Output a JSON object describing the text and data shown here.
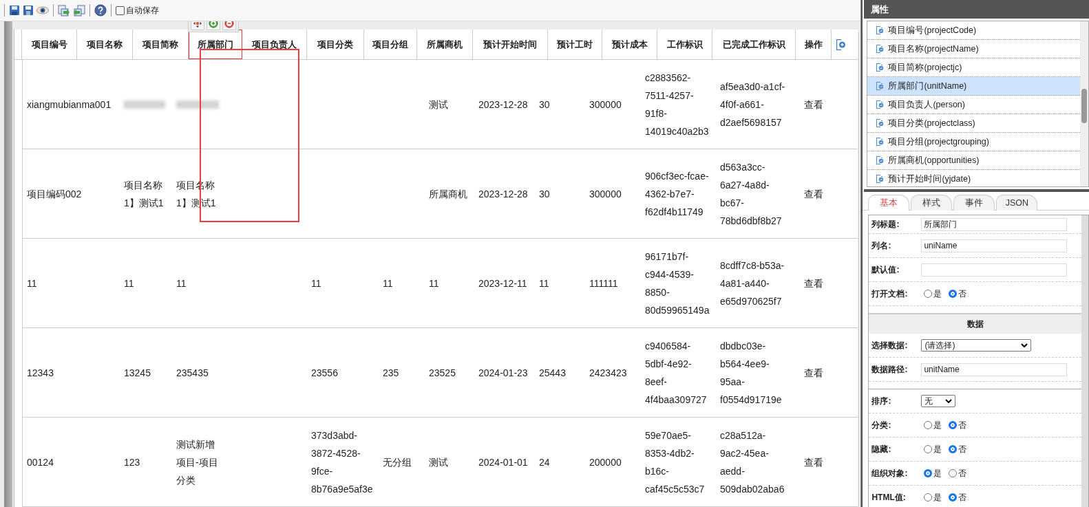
{
  "toolbar": {
    "autosave": {
      "label": "自动保存",
      "checked": false
    }
  },
  "columns": [
    {
      "label": "项目编号",
      "selected": false
    },
    {
      "label": "项目名称",
      "selected": false
    },
    {
      "label": "项目简称",
      "selected": false
    },
    {
      "label": "所属部门",
      "selected": true
    },
    {
      "label": "项目负责人",
      "selected": false
    },
    {
      "label": "项目分类",
      "selected": false
    },
    {
      "label": "项目分组",
      "selected": false
    },
    {
      "label": "所属商机",
      "selected": false
    },
    {
      "label": "预计开始时间",
      "selected": false
    },
    {
      "label": "预计工时",
      "selected": false
    },
    {
      "label": "预计成本",
      "selected": false
    },
    {
      "label": "工作标识",
      "selected": false
    },
    {
      "label": "已完成工作标识",
      "selected": false
    },
    {
      "label": "操作",
      "selected": false
    }
  ],
  "rows": [
    {
      "cells": [
        "xiangmubianma001",
        {
          "kind": "blurred"
        },
        {
          "kind": "blurred"
        },
        null,
        null,
        null,
        null,
        "测试",
        "2023-12-28",
        "30",
        "300000",
        "c2883562-7511-4257-91f8-14019c40a2b3",
        "af5ea3d0-a1cf-4f0f-a661-d2aef5698157",
        "查看"
      ]
    },
    {
      "cells": [
        "项目编码002",
        "项目名称1】测试1",
        "项目名称1】测试1",
        null,
        null,
        null,
        null,
        "所属商机",
        "2023-12-28",
        "30",
        "300000",
        "906cf3ec-fcae-4362-b7e7-f62df4b11749",
        "d563a3cc-6a27-4a8d-bc67-78bd6dbf8b27",
        "查看"
      ]
    },
    {
      "cells": [
        "11",
        "11",
        "11",
        null,
        null,
        "11",
        "11",
        "11",
        "2023-12-11",
        "11",
        "111111",
        "96171b7f-c944-4539-8850-80d59965149a",
        "8cdff7c8-b53a-4a81-a440-e65d970625f7",
        "查看"
      ]
    },
    {
      "cells": [
        "12343",
        "13245",
        "235435",
        null,
        null,
        "23556",
        "235",
        "23525",
        "2024-01-23",
        "25443",
        "2423423",
        "c9406584-5dbf-4e92-8eef-4f4baa309727",
        "dbdbc03e-b564-4ee9-95aa-f0554d91719e",
        "查看"
      ]
    },
    {
      "cells": [
        "00124",
        "123",
        "测试新增项目-项目分类",
        null,
        null,
        "373d3abd-3872-4528-9fce-8b76a9e5af3e",
        "无分组",
        "测试",
        "2024-01-01",
        "24",
        "200000",
        "59e70ae5-8353-4db2-b16c-caf45c5c53c7",
        "c28a512a-9ac2-45ea-aedd-509dab02aba6",
        "查看"
      ]
    }
  ],
  "properties": {
    "title": "属性",
    "fields": [
      {
        "label": "项目编号(projectCode)",
        "selected": false
      },
      {
        "label": "项目名称(projectName)",
        "selected": false
      },
      {
        "label": "项目简称(projectjc)",
        "selected": false
      },
      {
        "label": "所属部门(unitName)",
        "selected": true
      },
      {
        "label": "项目负责人(person)",
        "selected": false
      },
      {
        "label": "项目分类(projectclass)",
        "selected": false
      },
      {
        "label": "项目分组(projectgrouping)",
        "selected": false
      },
      {
        "label": "所属商机(opportunities)",
        "selected": false
      },
      {
        "label": "预计开始时间(yjdate)",
        "selected": false
      }
    ],
    "tabs": [
      {
        "label": "基本",
        "selected": true
      },
      {
        "label": "样式",
        "selected": false
      },
      {
        "label": "事件",
        "selected": false
      },
      {
        "label": "JSON",
        "selected": false
      }
    ],
    "form": [
      {
        "kind": "text",
        "label": "列标题:",
        "value": "所属部门"
      },
      {
        "kind": "text",
        "label": "列名:",
        "value": "uniName"
      },
      {
        "kind": "text",
        "label": "默认值:"
      },
      {
        "kind": "radio",
        "label": "打开文档:",
        "options": [
          {
            "label": "是",
            "selected": false
          },
          {
            "label": "否",
            "selected": true
          }
        ]
      },
      {
        "kind": "section",
        "label": "数据"
      },
      {
        "kind": "select",
        "label": "选择数据:",
        "value": "(请选择)"
      },
      {
        "kind": "text",
        "label": "数据路径:",
        "value": "unitName"
      },
      {
        "kind": "rule"
      },
      {
        "kind": "smallselect",
        "label": "排序:",
        "value": "无"
      },
      {
        "kind": "radio",
        "label": "分类:",
        "options": [
          {
            "label": "是",
            "selected": false
          },
          {
            "label": "否",
            "selected": true
          }
        ]
      },
      {
        "kind": "radio",
        "label": "隐藏:",
        "options": [
          {
            "label": "是",
            "selected": false
          },
          {
            "label": "否",
            "selected": true
          }
        ]
      },
      {
        "kind": "radio",
        "label": "组织对象:",
        "options": [
          {
            "label": "是",
            "selected": true
          },
          {
            "label": "否",
            "selected": false
          }
        ]
      },
      {
        "kind": "radio",
        "label": "HTML值:",
        "options": [
          {
            "label": "是",
            "selected": false
          },
          {
            "label": "否",
            "selected": true
          }
        ]
      }
    ]
  }
}
